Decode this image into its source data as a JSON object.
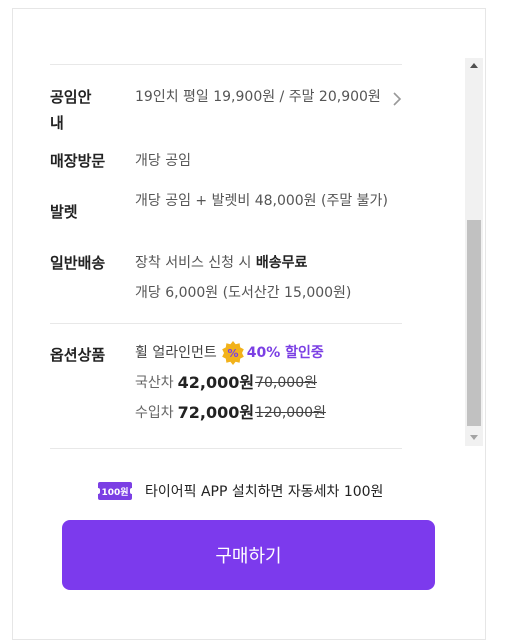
{
  "colors": {
    "accent": "#7c3aed",
    "discount_text": "#7b3fe4",
    "badge_gold": "#f2b21b"
  },
  "rows": [
    {
      "label": "공임안내",
      "value": "19인치 평일 19,900원 / 주말 20,900원",
      "icon": "chevron-right-icon"
    },
    {
      "label": "매장방문",
      "value": "개당 공임"
    },
    {
      "label": "발렛",
      "value": "개당 공임 + 발렛비 48,000원 (주말 불가)"
    },
    {
      "label": "일반배송",
      "value_prefix": "장착 서비스 신청 시 ",
      "value_bold": "배송무료",
      "value_sub": "개당 6,000원 (도서산간 15,000원)"
    }
  ],
  "options": {
    "label": "옵션상품",
    "title": "휠 얼라인먼트",
    "badge_icon": "discount-badge-icon",
    "discount": "40% 할인중",
    "items": [
      {
        "origin": "국산차",
        "price": "42,000원",
        "old_price": "70,000원"
      },
      {
        "origin": "수입차",
        "price": "72,000원",
        "old_price": "120,000원"
      }
    ]
  },
  "promo": {
    "badge": "100원",
    "text": "타이어픽 APP 설치하면 자동세차 100원"
  },
  "buy_button": {
    "label": "구매하기"
  }
}
